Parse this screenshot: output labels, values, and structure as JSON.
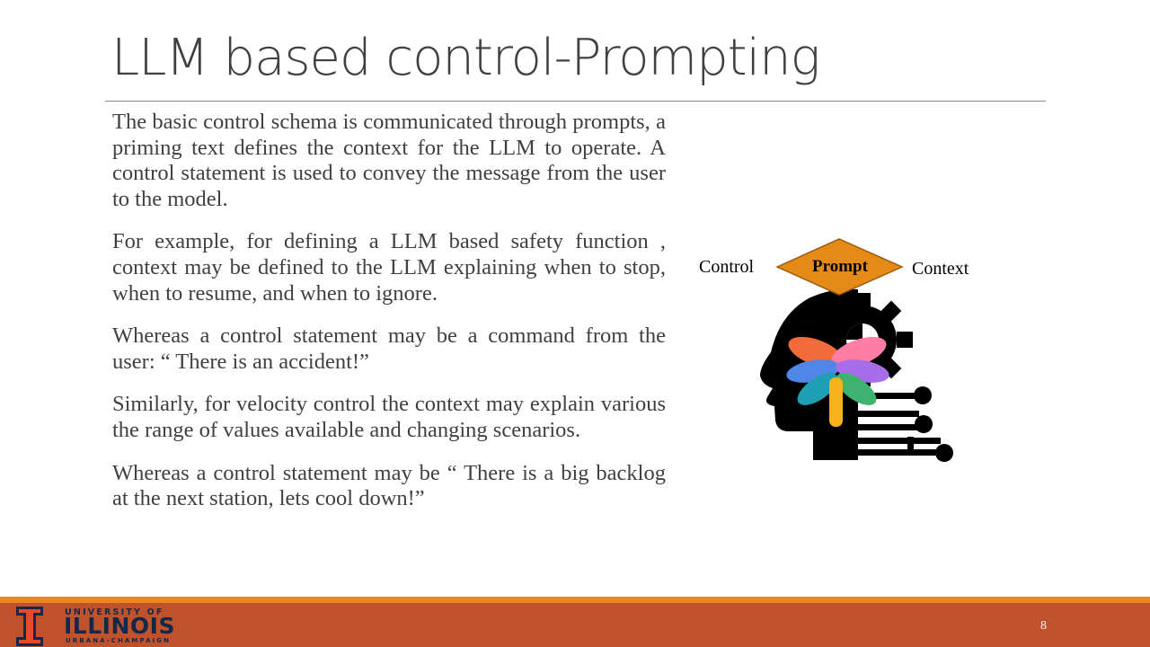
{
  "slide": {
    "title": "LLM based control-Prompting",
    "paragraphs": [
      "The basic control schema is communicated through prompts, a priming text defines the context for the LLM to operate. A control statement is used to convey the message from the user to the model.",
      "For example, for defining a LLM based safety function , context may be defined to the LLM explaining when to stop, when to resume, and when to ignore.",
      "Whereas a control statement may be a command from the user: “ There is an accident!”",
      "Similarly, for velocity control the context may explain various the range of values available and changing scenarios.",
      "Whereas a control statement may be “ There is a big backlog at the next station, lets cool down!”"
    ],
    "page_number": "8"
  },
  "figure": {
    "left_label": "Control",
    "center_label": "Prompt",
    "right_label": "Context",
    "diamond_color": "#e58a17",
    "icon": "head-gear-circuit-icon"
  },
  "footer": {
    "logo_line1": "UNIVERSITY OF",
    "logo_line2": "ILLINOIS",
    "logo_line3": "URBANA-CHAMPAIGN",
    "accent_stripe": "#e9871c",
    "bar_color": "#c0522b"
  }
}
